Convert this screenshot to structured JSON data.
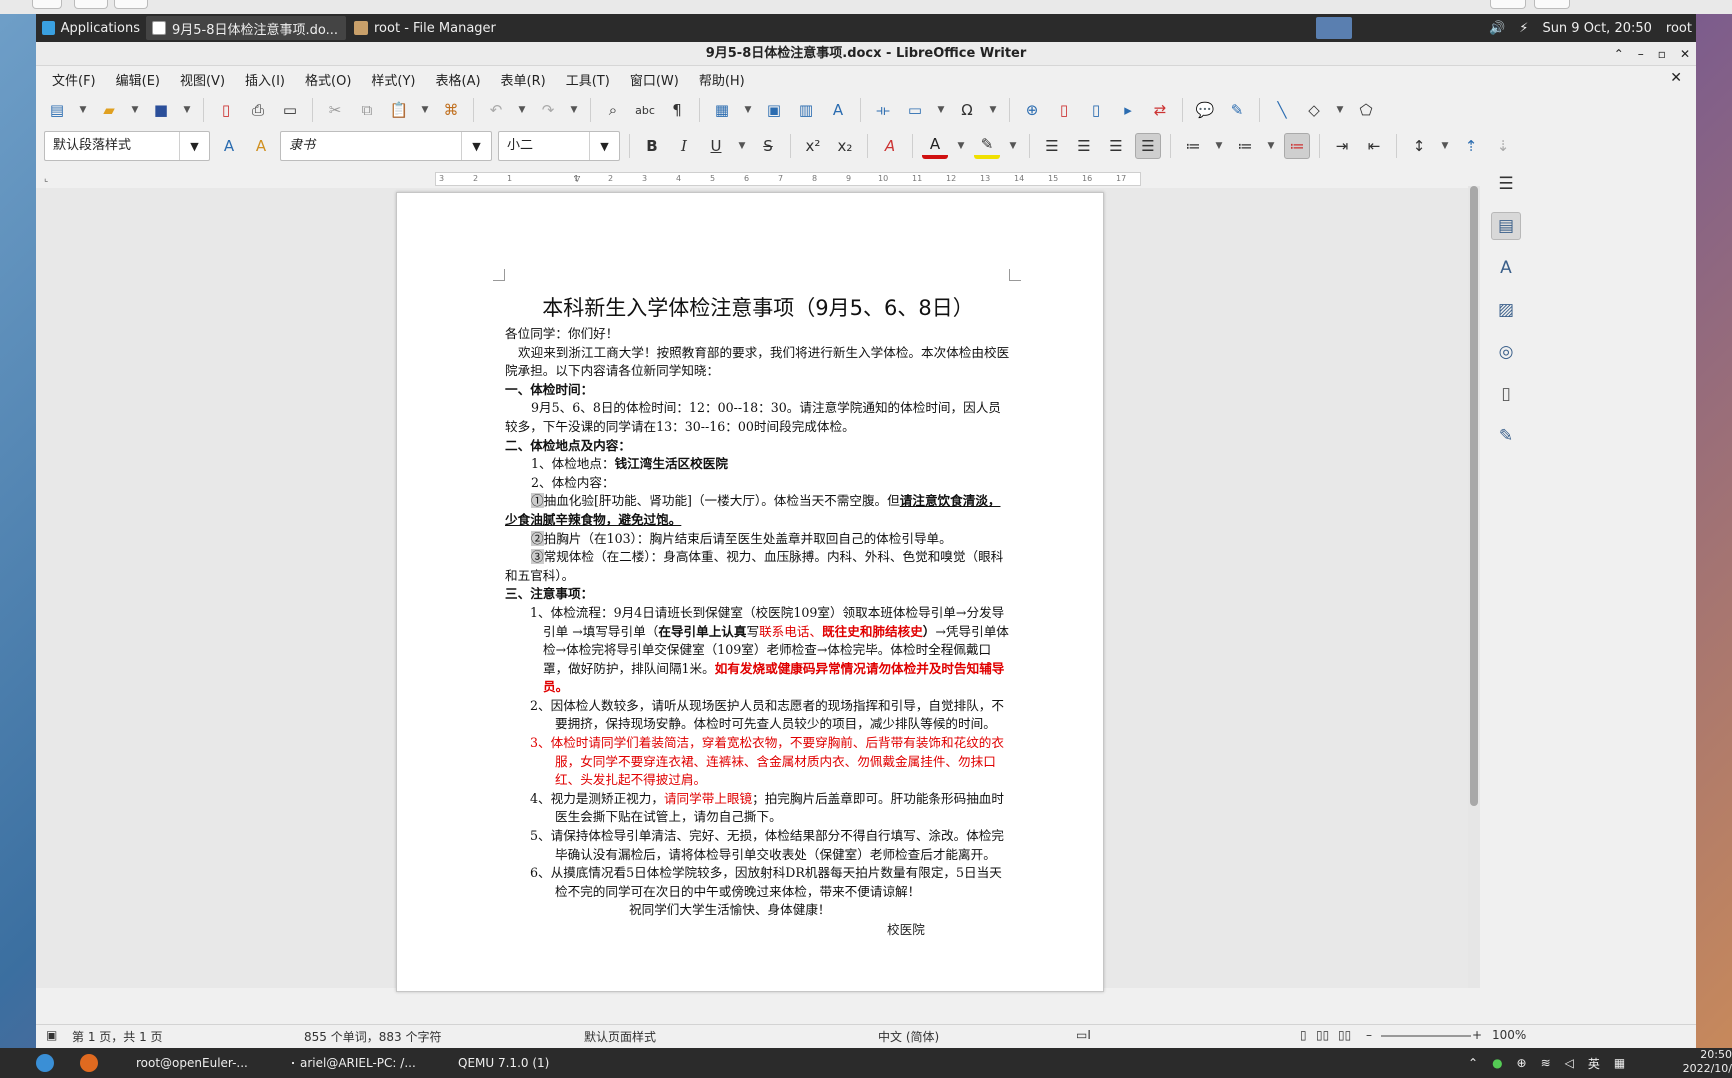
{
  "panel": {
    "applications": "Applications",
    "tasks": [
      "9月5-8日体检注意事项.do...",
      "root - File Manager"
    ],
    "date": "Sun  9 Oct, 20:50",
    "user": "root"
  },
  "window": {
    "title": "9月5-8日体检注意事项.docx - LibreOffice Writer"
  },
  "menu": [
    "文件(F)",
    "编辑(E)",
    "视图(V)",
    "插入(I)",
    "格式(O)",
    "样式(Y)",
    "表格(A)",
    "表单(R)",
    "工具(T)",
    "窗口(W)",
    "帮助(H)"
  ],
  "format": {
    "para_style": "默认段落样式",
    "font": "隶书",
    "size": "小二"
  },
  "ruler": [
    "3",
    "2",
    "1",
    "1",
    "2",
    "3",
    "4",
    "5",
    "6",
    "7",
    "8",
    "9",
    "10",
    "11",
    "12",
    "13",
    "14",
    "15",
    "16",
    "17"
  ],
  "doc": {
    "title": "本科新生入学体检注意事项（9月5、6、8日）",
    "greeting": "各位同学：你们好！",
    "intro": "欢迎来到浙江工商大学！按照教育部的要求，我们将进行新生入学体检。本次体检由校医院承担。以下内容请各位新同学知晓：",
    "s1_head": "一、体检时间：",
    "s1_text": "9月5、6、8日的体检时间：12：00--18：30。请注意学院通知的体检时间，因人员较多，下午没课的同学请在13：30--16：00时间段完成体检。",
    "s2_head": "二、体检地点及内容：",
    "s2_loc_label": "1、体检地点：",
    "s2_loc": "钱江湾生活区校医院",
    "s2_content_label": "2、体检内容：",
    "item1_num": "①",
    "item1_text": "抽血化验[肝功能、肾功能]（一楼大厅）。体检当天不需空腹。但",
    "item1_bold": "请注意饮食清淡，少食油腻辛辣食物，避免过饱。",
    "item2_num": "②",
    "item2_text": "拍胸片（在103）：胸片结束后请至医生处盖章并取回自己的体检引导单。",
    "item3_num": "③",
    "item3_text": "常规体检（在二楼）：身高体重、视力、血压脉搏。内科、外科、色觉和嗅觉（眼科和五官科）。",
    "s3_head": "三、注意事项：",
    "n1_a": "1、体检流程：9月4日请班长到保健室（校医院109室）领取本班体检导引单→分发导引单 →填写导引单（",
    "n1_b": "在导引单上认真",
    "n1_c": "写",
    "n1_red1": "联系电话、",
    "n1_red2": "既往史和肺结核史",
    "n1_d": "）",
    "n1_e": "→凭导引单体检→体检完将导引单交保健室（109室）老师检查→体检完毕。体检时全程佩戴口罩，做好防护，排队间隔1米。",
    "n1_red3": "如有发烧或健康码异常情况请勿体检并及时告知辅导员。",
    "n2": "2、因体检人数较多，请听从现场医护人员和志愿者的现场指挥和引导，自觉排队，不要拥挤，保持现场安静。体检时可先查人员较少的项目，减少排队等候的时间。",
    "n3": "3、体检时请同学们着装简洁，穿着宽松衣物，不要穿胸前、后背带有装饰和花纹的衣服，女同学不要穿连衣裙、连裤袜、含金属材质内衣、勿佩戴金属挂件、勿抹口红、头发扎起不得披过肩。",
    "n4_a": "4、视力是测矫正视力，",
    "n4_red": "请同学带上眼镜",
    "n4_b": "；拍完胸片后盖章即可。肝功能条形码抽血时医生会撕下贴在试管上，请勿自己撕下。",
    "n5": "5、请保持体检导引单清洁、完好、无损，体检结果部分不得自行填写、涂改。体检完毕确认没有漏检后，请将体检导引单交收表处（保健室）老师检查后才能离开。",
    "n6": "6、从摸底情况看5日体检学院较多，因放射科DR机器每天拍片数量有限定，5日当天检不完的同学可在次日的中午或傍晚过来体检，带来不便请谅解！",
    "closing": "祝同学们大学生活愉快、身体健康！",
    "signature": "校医院"
  },
  "status": {
    "page": "第 1 页，共 1 页",
    "words": "855 个单词，883 个字符",
    "page_style": "默认页面样式",
    "language": "中文 (简体)",
    "zoom": "100%"
  },
  "taskbar": {
    "tasks": [
      "root@openEuler-...",
      "ariel@ARIEL-PC: /...",
      "QEMU 7.1.0 (1)"
    ],
    "ime": "英",
    "time": "20:50",
    "date": "2022/10/"
  }
}
